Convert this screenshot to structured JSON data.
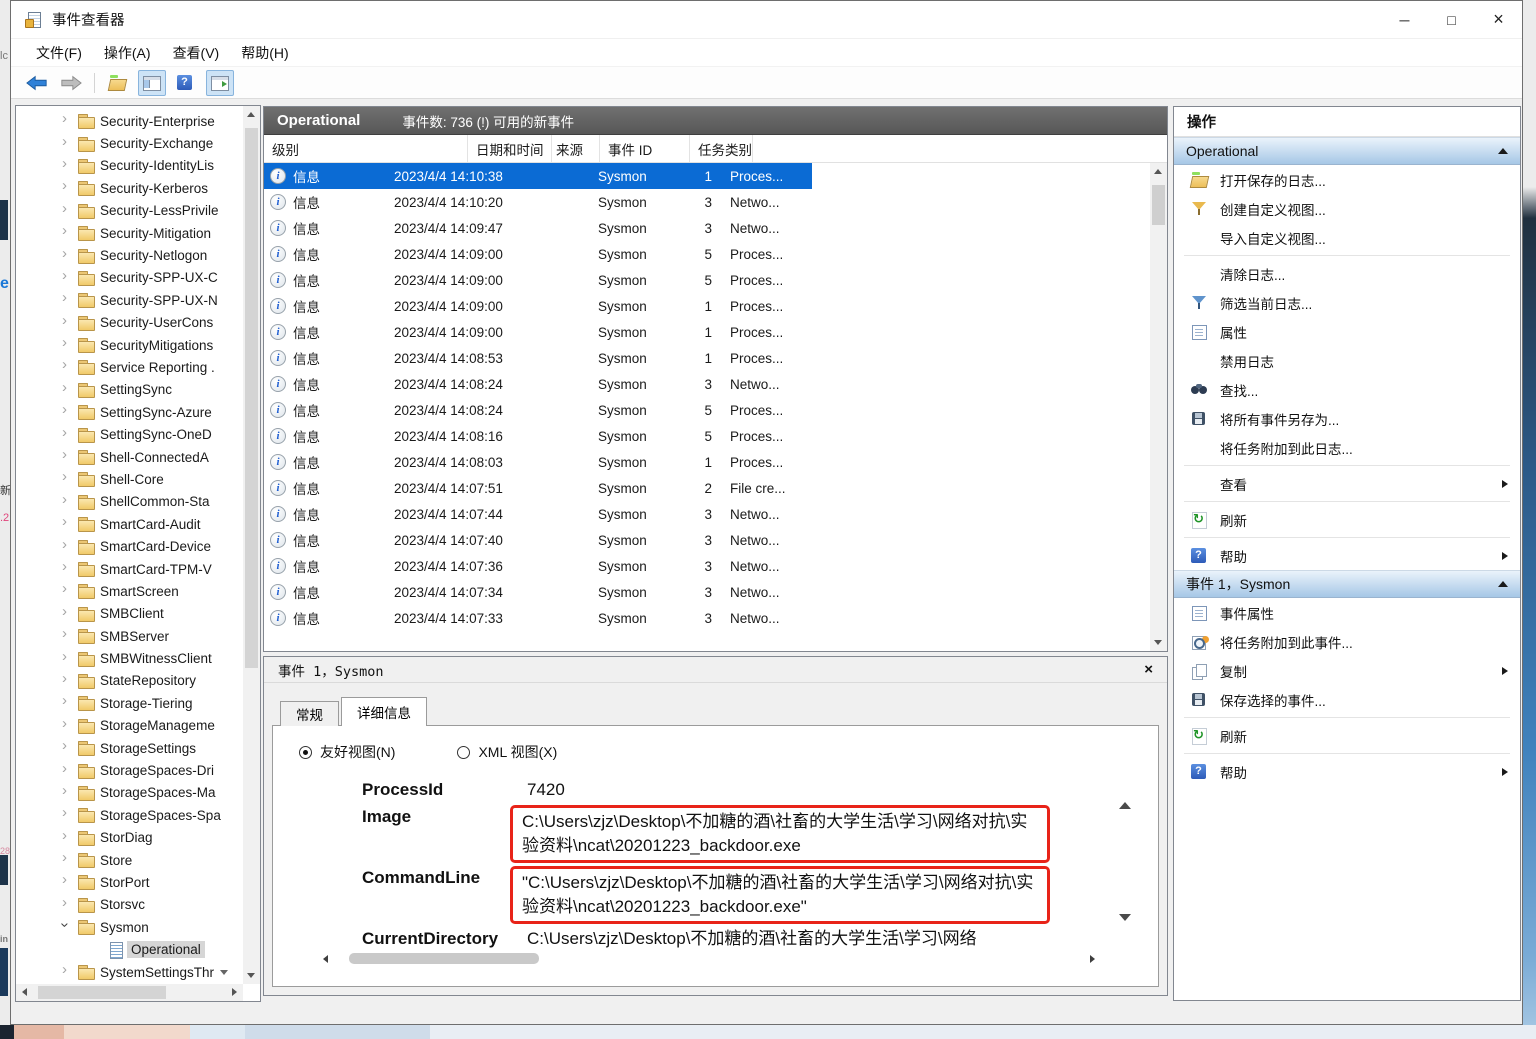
{
  "window": {
    "title": "事件查看器",
    "controls": {
      "minimize": "─",
      "maximize": "□",
      "close": "×"
    }
  },
  "menu": {
    "items": [
      {
        "label": "文件(F)"
      },
      {
        "label": "操作(A)"
      },
      {
        "label": "查看(V)"
      },
      {
        "label": "帮助(H)"
      }
    ]
  },
  "toolbar": {
    "buttons": [
      "back-icon",
      "forward-icon",
      "open-folder-icon",
      "console-tree-icon",
      "help-icon",
      "action-pane-icon"
    ]
  },
  "tree": {
    "items": [
      {
        "label": "Security-Enterprise",
        "state": "collapsed",
        "icon": "folder-icon"
      },
      {
        "label": "Security-Exchange",
        "state": "collapsed",
        "icon": "folder-icon"
      },
      {
        "label": "Security-IdentityLis",
        "state": "collapsed",
        "icon": "folder-icon"
      },
      {
        "label": "Security-Kerberos",
        "state": "collapsed",
        "icon": "folder-icon"
      },
      {
        "label": "Security-LessPrivile",
        "state": "collapsed",
        "icon": "folder-icon"
      },
      {
        "label": "Security-Mitigation",
        "state": "collapsed",
        "icon": "folder-icon"
      },
      {
        "label": "Security-Netlogon",
        "state": "collapsed",
        "icon": "folder-icon"
      },
      {
        "label": "Security-SPP-UX-C",
        "state": "collapsed",
        "icon": "folder-icon"
      },
      {
        "label": "Security-SPP-UX-N",
        "state": "collapsed",
        "icon": "folder-icon"
      },
      {
        "label": "Security-UserCons",
        "state": "collapsed",
        "icon": "folder-icon"
      },
      {
        "label": "SecurityMitigations",
        "state": "collapsed",
        "icon": "folder-icon"
      },
      {
        "label": "Service Reporting .",
        "state": "collapsed",
        "icon": "folder-icon"
      },
      {
        "label": "SettingSync",
        "state": "collapsed",
        "icon": "folder-icon"
      },
      {
        "label": "SettingSync-Azure",
        "state": "collapsed",
        "icon": "folder-icon"
      },
      {
        "label": "SettingSync-OneD",
        "state": "collapsed",
        "icon": "folder-icon"
      },
      {
        "label": "Shell-ConnectedA",
        "state": "collapsed",
        "icon": "folder-icon"
      },
      {
        "label": "Shell-Core",
        "state": "collapsed",
        "icon": "folder-icon"
      },
      {
        "label": "ShellCommon-Sta",
        "state": "collapsed",
        "icon": "folder-icon"
      },
      {
        "label": "SmartCard-Audit",
        "state": "collapsed",
        "icon": "folder-icon"
      },
      {
        "label": "SmartCard-Device",
        "state": "collapsed",
        "icon": "folder-icon"
      },
      {
        "label": "SmartCard-TPM-V",
        "state": "collapsed",
        "icon": "folder-icon"
      },
      {
        "label": "SmartScreen",
        "state": "collapsed",
        "icon": "folder-icon"
      },
      {
        "label": "SMBClient",
        "state": "collapsed",
        "icon": "folder-icon"
      },
      {
        "label": "SMBServer",
        "state": "collapsed",
        "icon": "folder-icon"
      },
      {
        "label": "SMBWitnessClient",
        "state": "collapsed",
        "icon": "folder-icon"
      },
      {
        "label": "StateRepository",
        "state": "collapsed",
        "icon": "folder-icon"
      },
      {
        "label": "Storage-Tiering",
        "state": "collapsed",
        "icon": "folder-icon"
      },
      {
        "label": "StorageManageme",
        "state": "collapsed",
        "icon": "folder-icon"
      },
      {
        "label": "StorageSettings",
        "state": "collapsed",
        "icon": "folder-icon"
      },
      {
        "label": "StorageSpaces-Dri",
        "state": "collapsed",
        "icon": "folder-icon"
      },
      {
        "label": "StorageSpaces-Ma",
        "state": "collapsed",
        "icon": "folder-icon"
      },
      {
        "label": "StorageSpaces-Spa",
        "state": "collapsed",
        "icon": "folder-icon"
      },
      {
        "label": "StorDiag",
        "state": "collapsed",
        "icon": "folder-icon"
      },
      {
        "label": "Store",
        "state": "collapsed",
        "icon": "folder-icon"
      },
      {
        "label": "StorPort",
        "state": "collapsed",
        "icon": "folder-icon"
      },
      {
        "label": "Storsvc",
        "state": "collapsed",
        "icon": "folder-icon"
      },
      {
        "label": "Sysmon",
        "state": "expanded",
        "icon": "folder-icon"
      },
      {
        "label": "Operational",
        "state": "leaf",
        "icon": "log-icon",
        "indent": 1,
        "selected": true
      },
      {
        "label": "SystemSettingsThr",
        "state": "collapsed",
        "icon": "folder-icon",
        "scroll_hint": "down"
      }
    ]
  },
  "events": {
    "log_title": "Operational",
    "summary": "事件数: 736 (!) 可用的新事件",
    "columns": [
      {
        "label": "级别"
      },
      {
        "label": "日期和时间"
      },
      {
        "label": "来源"
      },
      {
        "label": "事件 ID"
      },
      {
        "label": "任务类别"
      }
    ],
    "rows": [
      {
        "level": "信息",
        "datetime": "2023/4/4 14:10:38",
        "source": "Sysmon",
        "id": "1",
        "category": "Proces...",
        "selected": true
      },
      {
        "level": "信息",
        "datetime": "2023/4/4 14:10:20",
        "source": "Sysmon",
        "id": "3",
        "category": "Netwo..."
      },
      {
        "level": "信息",
        "datetime": "2023/4/4 14:09:47",
        "source": "Sysmon",
        "id": "3",
        "category": "Netwo..."
      },
      {
        "level": "信息",
        "datetime": "2023/4/4 14:09:00",
        "source": "Sysmon",
        "id": "5",
        "category": "Proces..."
      },
      {
        "level": "信息",
        "datetime": "2023/4/4 14:09:00",
        "source": "Sysmon",
        "id": "5",
        "category": "Proces..."
      },
      {
        "level": "信息",
        "datetime": "2023/4/4 14:09:00",
        "source": "Sysmon",
        "id": "1",
        "category": "Proces..."
      },
      {
        "level": "信息",
        "datetime": "2023/4/4 14:09:00",
        "source": "Sysmon",
        "id": "1",
        "category": "Proces..."
      },
      {
        "level": "信息",
        "datetime": "2023/4/4 14:08:53",
        "source": "Sysmon",
        "id": "1",
        "category": "Proces..."
      },
      {
        "level": "信息",
        "datetime": "2023/4/4 14:08:24",
        "source": "Sysmon",
        "id": "3",
        "category": "Netwo..."
      },
      {
        "level": "信息",
        "datetime": "2023/4/4 14:08:24",
        "source": "Sysmon",
        "id": "5",
        "category": "Proces..."
      },
      {
        "level": "信息",
        "datetime": "2023/4/4 14:08:16",
        "source": "Sysmon",
        "id": "5",
        "category": "Proces..."
      },
      {
        "level": "信息",
        "datetime": "2023/4/4 14:08:03",
        "source": "Sysmon",
        "id": "1",
        "category": "Proces..."
      },
      {
        "level": "信息",
        "datetime": "2023/4/4 14:07:51",
        "source": "Sysmon",
        "id": "2",
        "category": "File cre..."
      },
      {
        "level": "信息",
        "datetime": "2023/4/4 14:07:44",
        "source": "Sysmon",
        "id": "3",
        "category": "Netwo..."
      },
      {
        "level": "信息",
        "datetime": "2023/4/4 14:07:40",
        "source": "Sysmon",
        "id": "3",
        "category": "Netwo..."
      },
      {
        "level": "信息",
        "datetime": "2023/4/4 14:07:36",
        "source": "Sysmon",
        "id": "3",
        "category": "Netwo..."
      },
      {
        "level": "信息",
        "datetime": "2023/4/4 14:07:34",
        "source": "Sysmon",
        "id": "3",
        "category": "Netwo..."
      },
      {
        "level": "信息",
        "datetime": "2023/4/4 14:07:33",
        "source": "Sysmon",
        "id": "3",
        "category": "Netwo..."
      }
    ]
  },
  "details": {
    "title": "事件 1，Sysmon",
    "close_glyph": "×",
    "tabs": [
      {
        "label": "常规"
      },
      {
        "label": "详细信息",
        "active": true
      }
    ],
    "views": [
      {
        "label": "友好视图(N)",
        "selected": true
      },
      {
        "label": "XML 视图(X)"
      }
    ],
    "fields": [
      {
        "name": "ProcessId",
        "value": "7420"
      },
      {
        "name": "Image",
        "value": "C:\\Users\\zjz\\Desktop\\不加糖的酒\\社畜的大学生活\\学习\\网络对抗\\实验资料\\ncat\\20201223_backdoor.exe",
        "highlighted": true
      },
      {
        "name": "CommandLine",
        "value": "\"C:\\Users\\zjz\\Desktop\\不加糖的酒\\社畜的大学生活\\学习\\网络对抗\\实验资料\\ncat\\20201223_backdoor.exe\"",
        "highlighted": true
      },
      {
        "name": "CurrentDirectory",
        "value": "C:\\Users\\zjz\\Desktop\\不加糖的酒\\社畜的大学生活\\学习\\网络",
        "clipped": true
      }
    ]
  },
  "actions": {
    "panel_title": "操作",
    "sections": [
      {
        "header": "Operational",
        "items": [
          {
            "icon": "open-folder-icon",
            "label": "打开保存的日志..."
          },
          {
            "icon": "funnel-yellow-icon",
            "label": "创建自定义视图..."
          },
          {
            "icon": null,
            "label": "导入自定义视图..."
          },
          {
            "icon": null,
            "label": "清除日志...",
            "divider_before": true
          },
          {
            "icon": "funnel-blue-icon",
            "label": "筛选当前日志..."
          },
          {
            "icon": "properties-icon",
            "label": "属性"
          },
          {
            "icon": null,
            "label": "禁用日志"
          },
          {
            "icon": "binoculars-icon",
            "label": "查找..."
          },
          {
            "icon": "floppy-icon",
            "label": "将所有事件另存为..."
          },
          {
            "icon": null,
            "label": "将任务附加到此日志..."
          },
          {
            "icon": null,
            "label": "查看",
            "arrow": true,
            "divider_before": true
          },
          {
            "icon": "refresh-icon",
            "label": "刷新",
            "divider_before": true
          },
          {
            "icon": "help-icon",
            "label": "帮助",
            "arrow": true,
            "divider_before": true
          }
        ]
      },
      {
        "header": "事件 1，Sysmon",
        "items": [
          {
            "icon": "properties-icon",
            "label": "事件属性"
          },
          {
            "icon": "task-clock-icon",
            "label": "将任务附加到此事件..."
          },
          {
            "icon": "copy-icon",
            "label": "复制",
            "arrow": true
          },
          {
            "icon": "floppy-icon",
            "label": "保存选择的事件..."
          },
          {
            "icon": "refresh-icon",
            "label": "刷新",
            "divider_before": true
          },
          {
            "icon": "help-icon",
            "label": "帮助",
            "arrow": true,
            "divider_before": true
          }
        ]
      }
    ]
  },
  "background_fragments": {
    "left_texts": [
      "lc",
      "e",
      "新",
      ".2",
      "28,",
      "in"
    ]
  },
  "colors": {
    "accent_blue": "#0b6bd4",
    "selection_gray": "#d6d6d6",
    "annotation_red": "#e82318",
    "section_header_blue": "#a6c7e6",
    "list_title_gray": "#5f5f5f"
  }
}
